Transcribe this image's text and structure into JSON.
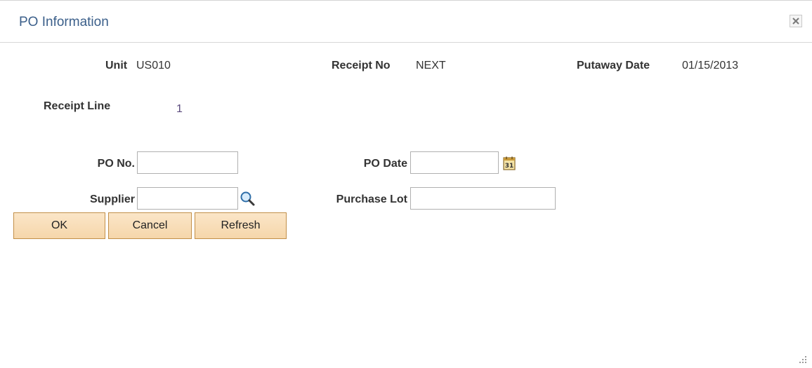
{
  "dialog": {
    "title": "PO Information"
  },
  "header_fields": {
    "unit": {
      "label": "Unit",
      "value": "US010"
    },
    "receipt_no": {
      "label": "Receipt No",
      "value": "NEXT"
    },
    "putaway_date": {
      "label": "Putaway Date",
      "value": "01/15/2013"
    },
    "receipt_line": {
      "label": "Receipt Line",
      "value": "1"
    }
  },
  "form": {
    "po_no": {
      "label": "PO No.",
      "value": ""
    },
    "po_date": {
      "label": "PO Date",
      "value": ""
    },
    "supplier": {
      "label": "Supplier",
      "value": ""
    },
    "purchase_lot": {
      "label": "Purchase Lot",
      "value": ""
    }
  },
  "buttons": {
    "ok": "OK",
    "cancel": "Cancel",
    "refresh": "Refresh"
  },
  "icons": {
    "close": "close-icon",
    "calendar": "calendar-icon",
    "lookup": "search-icon",
    "resize": "resize-grip-icon"
  },
  "colors": {
    "title": "#3b5f8a",
    "button_bg": "#f7dcb4",
    "button_border": "#c28f48",
    "value_purple": "#5b4a7d"
  }
}
